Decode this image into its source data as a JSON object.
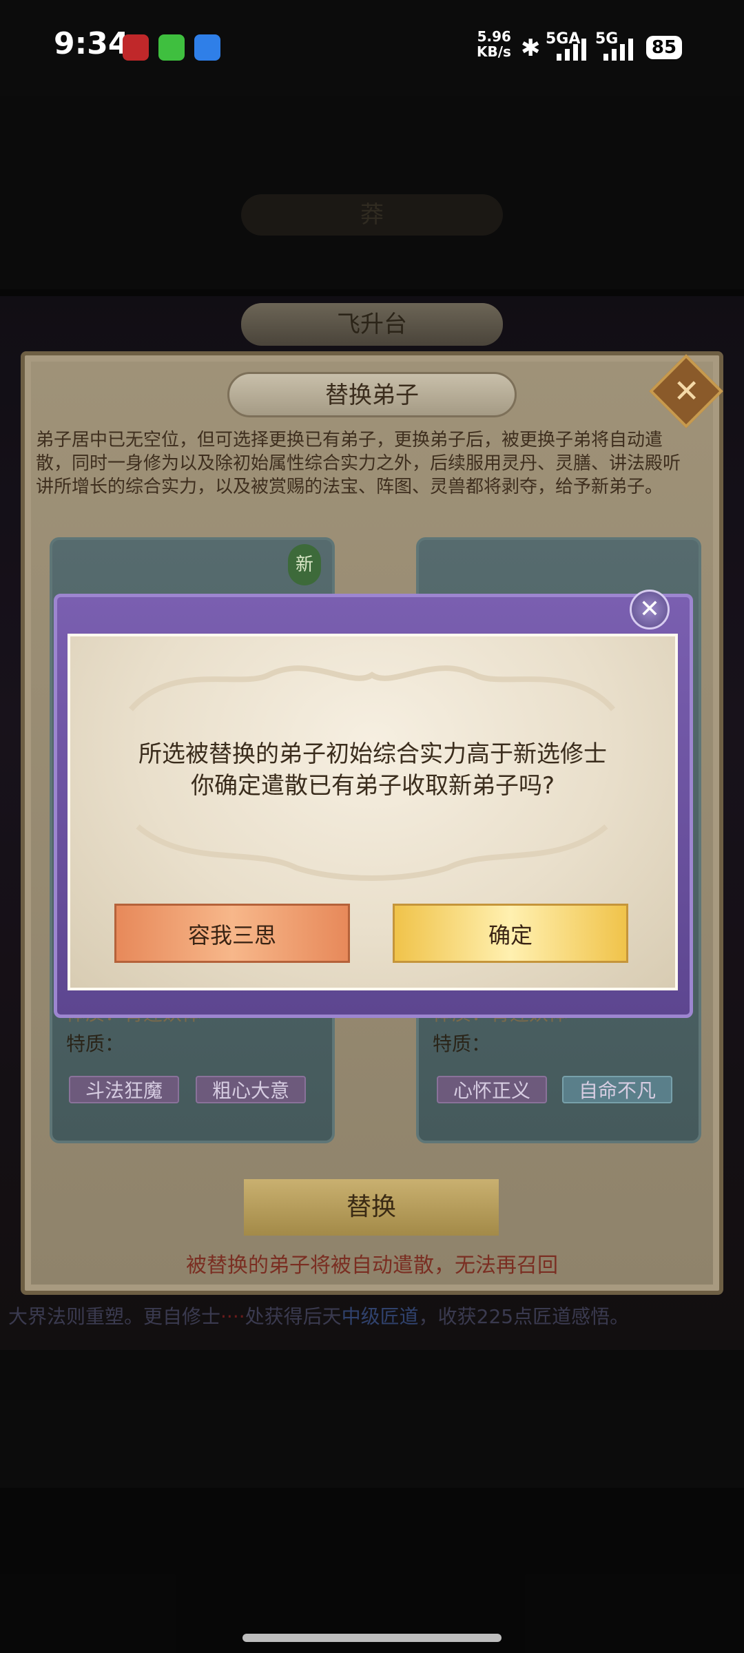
{
  "status_bar": {
    "time": "9:34",
    "net_speed_value": "5.96",
    "net_speed_unit": "KB/s",
    "signal1": "5GA",
    "signal2": "5G",
    "battery": "85"
  },
  "background": {
    "top_pill": "莽",
    "ascend_title": "飞升台",
    "log_line": "大界法则重塑。更自修士",
    "log_line_mid": "处获得后天",
    "log_line_mid2": "中级匠道",
    "log_line_end": "，收获225点匠道感悟。"
  },
  "panel": {
    "title": "替换弟子",
    "description": "弟子居中已无空位，但可选择更换已有弟子，更换弟子后，被更换子弟将自动遣散，同时一身修为以及除初始属性综合实力之外，后续服用灵丹、灵膳、讲法殿听讲所增长的综合实力，以及被赏赐的法宝、阵图、灵兽都将剥夺，给予新弟子。",
    "new_badge": "新",
    "left_card": {
      "physique": "体质：青莲妖体",
      "traits_label": "特质：",
      "traits": [
        "斗法狂魔",
        "粗心大意"
      ]
    },
    "right_card": {
      "physique": "体质：青莲妖体",
      "traits_label": "特质：",
      "traits": [
        "心怀正义",
        "自命不凡"
      ]
    },
    "replace_button": "替换",
    "warning": "被替换的弟子将被自动遣散，无法再召回"
  },
  "dialog": {
    "message_line1": "所选被替换的弟子初始综合实力高于新选修士",
    "message_line2": "你确定遣散已有弟子收取新弟子吗?",
    "cancel_label": "容我三思",
    "ok_label": "确定"
  }
}
